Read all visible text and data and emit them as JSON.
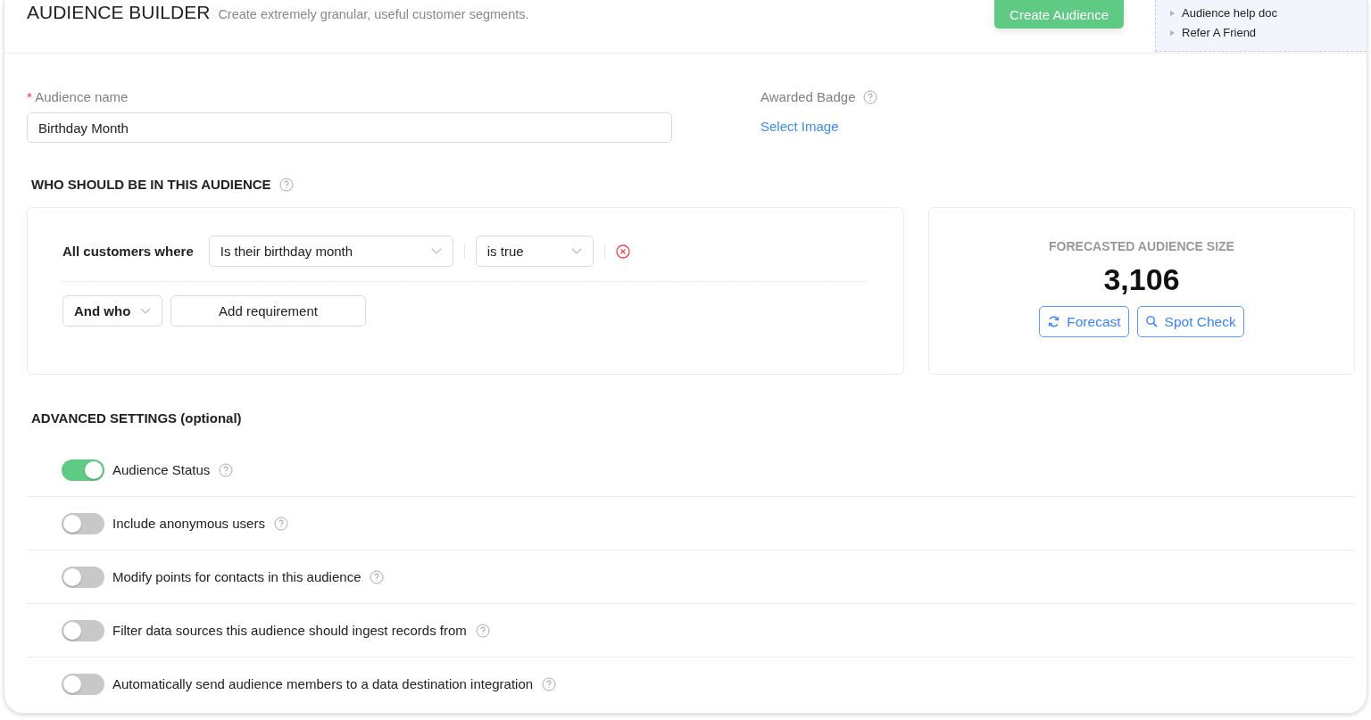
{
  "header": {
    "title": "AUDIENCE BUILDER",
    "subtitle": "Create extremely granular, useful customer segments.",
    "create_button": "Create Audience"
  },
  "help_links": [
    {
      "label": "Audience help doc",
      "expanded": false
    },
    {
      "label": "Refer A Friend",
      "expanded": false
    }
  ],
  "audience_name": {
    "label": "Audience name",
    "required": true,
    "required_mark": "*",
    "value": "Birthday Month"
  },
  "awarded_badge": {
    "label": "Awarded Badge",
    "link": "Select Image"
  },
  "who_section": {
    "title": "WHO SHOULD BE IN THIS AUDIENCE",
    "lead": "All customers where",
    "condition": "Is their birthday month",
    "operator": "is true",
    "connector": "And who",
    "add_button": "Add requirement"
  },
  "forecast": {
    "title": "FORECASTED AUDIENCE SIZE",
    "value": "3,106",
    "buttons": [
      {
        "label": "Forecast",
        "kind": "refresh"
      },
      {
        "label": "Spot Check",
        "kind": "search"
      }
    ]
  },
  "advanced_settings": {
    "title": "ADVANCED SETTINGS (optional)",
    "options": [
      {
        "label": "Audience Status",
        "on": true
      },
      {
        "label": "Include anonymous users",
        "on": false
      },
      {
        "label": "Modify points for contacts in this audience",
        "on": false
      },
      {
        "label": "Filter data sources this audience should ingest records from",
        "on": false
      },
      {
        "label": "Automatically send audience members to a data destination integration",
        "on": false
      }
    ]
  }
}
